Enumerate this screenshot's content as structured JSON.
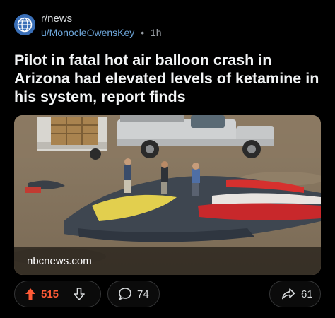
{
  "post": {
    "subreddit": "r/news",
    "author": "u/MonocleOwensKey",
    "separator": "•",
    "age": "1h",
    "title": "Pilot in fatal hot air balloon crash in Arizona had elevated levels of ketamine in his system, report finds",
    "link_domain": "nbcnews.com"
  },
  "actions": {
    "score": "515",
    "comments": "74",
    "shares": "61"
  },
  "colors": {
    "background": "#000000",
    "upvote_active": "#ff5a36",
    "author_link": "#6fa8dc",
    "pill_border": "#343536"
  },
  "icons": {
    "avatar": "globe-icon",
    "upvote": "upvote-arrow-icon",
    "downvote": "downvote-arrow-icon",
    "comment": "comment-bubble-icon",
    "share": "share-arrow-icon"
  }
}
